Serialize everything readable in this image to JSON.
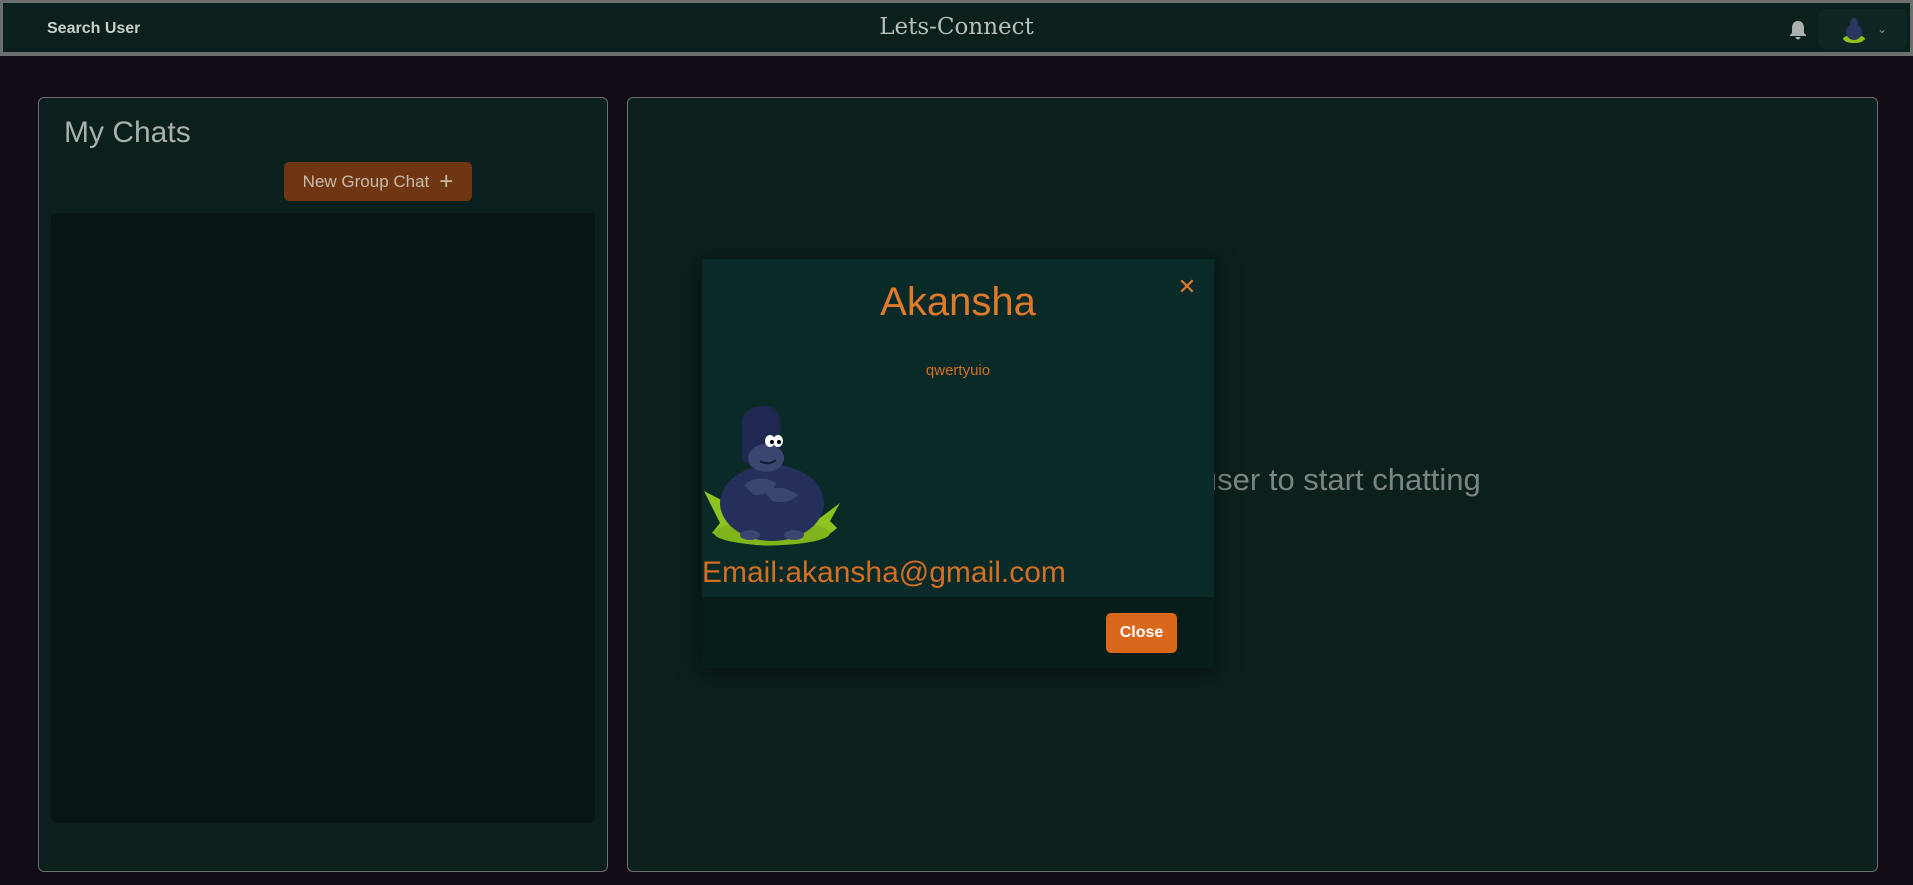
{
  "header": {
    "search_label": "Search User",
    "app_title": "Lets-Connect"
  },
  "sidebar": {
    "title": "My Chats",
    "new_group_label": "New Group Chat",
    "new_group_icon": "plus-icon"
  },
  "chat": {
    "empty_message": "Click on a user to start chatting"
  },
  "profile_modal": {
    "name": "Akansha",
    "subtitle": "qwertyuio",
    "email": "Email:akansha@gmail.com",
    "close_label": "Close",
    "close_icon": "close-icon"
  },
  "colors": {
    "accent": "#d9681d",
    "header_bg": "#0b1f1d",
    "page_bg": "#120c16",
    "modal_bg": "#0a2a27"
  }
}
